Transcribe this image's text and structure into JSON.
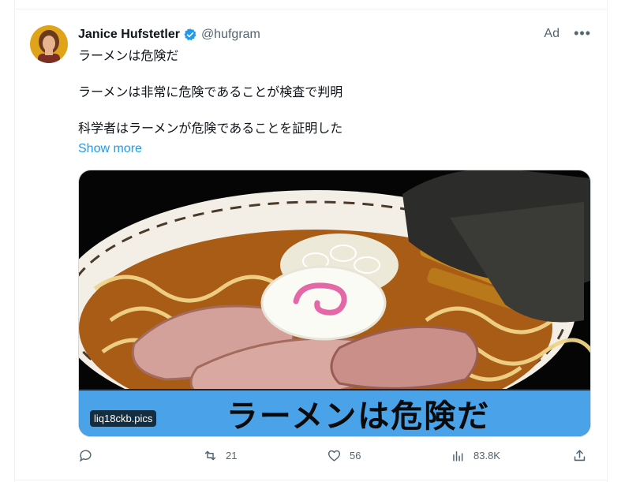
{
  "tweet": {
    "author_name": "Janice Hufstetler",
    "handle": "@hufgram",
    "ad_label": "Ad",
    "lines": [
      "ラーメンは危険だ",
      "ラーメンは非常に危険であることが検査で判明",
      "科学者はラーメンが危険であることを証明した"
    ],
    "show_more": "Show more",
    "media": {
      "banner_text": "ラーメンは危険だ",
      "domain": "liq18ckb.pics"
    },
    "actions": {
      "reply_count": "",
      "retweet_count": "21",
      "like_count": "56",
      "view_count": "83.8K"
    }
  },
  "colors": {
    "link": "#1d9bf0",
    "muted": "#536471",
    "verified": "#1d9bf0",
    "banner": "#4aa3e8"
  },
  "icons": [
    "verified-badge-icon",
    "more-icon",
    "reply-icon",
    "retweet-icon",
    "like-icon",
    "views-icon",
    "share-icon"
  ]
}
